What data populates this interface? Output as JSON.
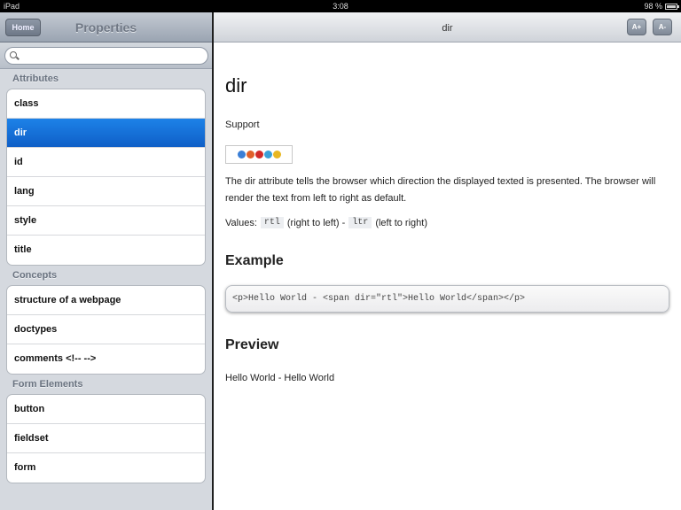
{
  "status_bar": {
    "device": "iPad",
    "time": "3:08",
    "battery": "98 %"
  },
  "left_pane": {
    "back_button": "Home",
    "title": "Properties",
    "search": {
      "value": "",
      "placeholder": ""
    },
    "sections": [
      {
        "header": "Attributes",
        "items": [
          "class",
          "dir",
          "id",
          "lang",
          "style",
          "title"
        ]
      },
      {
        "header": "Concepts",
        "items": [
          "structure of a webpage",
          "doctypes",
          "comments <!-- -->"
        ]
      },
      {
        "header": "Form Elements",
        "items": [
          "button",
          "fieldset",
          "form"
        ]
      }
    ],
    "selected_item": "dir"
  },
  "right_pane": {
    "nav_title": "dir",
    "font_increase_label": "A+",
    "font_decrease_label": "A-",
    "heading": "dir",
    "support_label": "Support",
    "browser_icons": [
      {
        "name": "ie-icon",
        "color": "#3b7fd6"
      },
      {
        "name": "firefox-icon",
        "color": "#e0602a"
      },
      {
        "name": "opera-icon",
        "color": "#d12a2a"
      },
      {
        "name": "safari-icon",
        "color": "#3aa0d8"
      },
      {
        "name": "chrome-icon",
        "color": "#e8b722"
      }
    ],
    "description": "The dir attribute tells the browser which direction the displayed texted is presented. The browser will render the text from left to right as default.",
    "values": {
      "prefix": "Values:",
      "rtl_code": "rtl",
      "rtl_desc": "(right to left) -",
      "ltr_code": "ltr",
      "ltr_desc": "(left to right)"
    },
    "example_title": "Example",
    "example_code": "<p>Hello World - <span dir=\"rtl\">Hello World</span></p>",
    "preview_title": "Preview",
    "preview_text": "Hello World - Hello World"
  },
  "colors": {
    "selected_row": "#1670d8",
    "sidebar_bg": "#d5d9df"
  }
}
